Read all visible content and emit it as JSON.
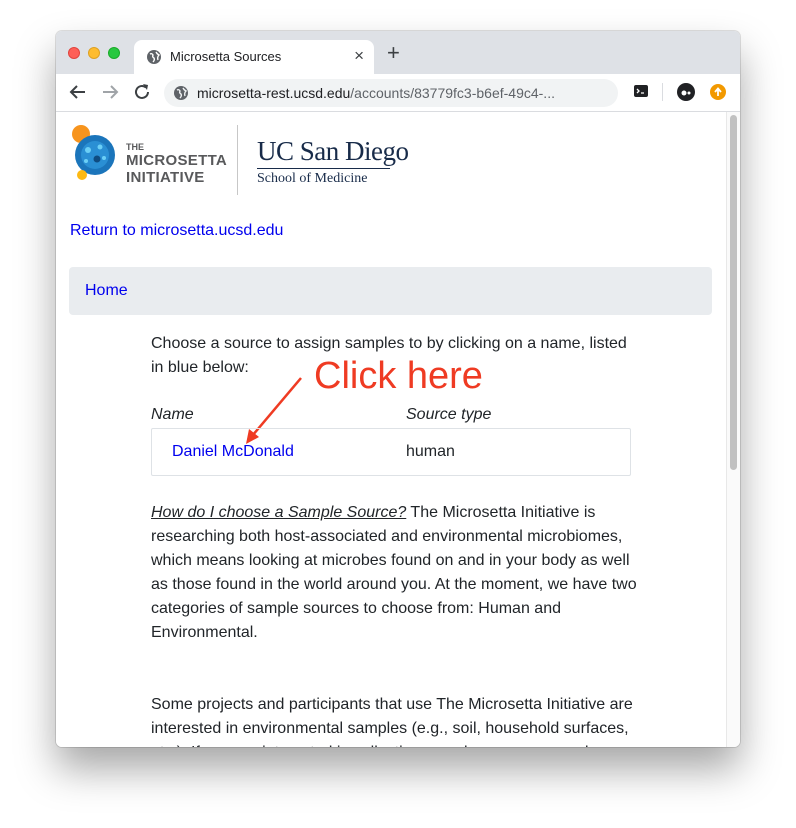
{
  "browser": {
    "tab_title": "Microsetta Sources",
    "tab_close": "×",
    "new_tab": "+",
    "url_host": "microsetta-rest.ucsd.edu",
    "url_path": "/accounts/83779fc3-b6ef-49c4-..."
  },
  "header": {
    "logo_line1": "THE",
    "logo_line2": "MICROSETTA",
    "logo_line3": "INITIATIVE",
    "ucsd_line1": "UC San Diego",
    "ucsd_line2": "School of Medicine"
  },
  "nav": {
    "return_link": "Return to microsetta.ucsd.edu",
    "breadcrumb_home": "Home"
  },
  "main": {
    "instructions": "Choose a source to assign samples to by clicking on a name, listed in blue below:",
    "col_name": "Name",
    "col_type": "Source type",
    "sources": [
      {
        "name": "Daniel McDonald",
        "type": "human"
      }
    ],
    "annotation": "Click here",
    "faq_question": "How do I choose a Sample Source?",
    "faq_answer": " The Microsetta Initiative is researching both host-associated and environmental microbiomes, which means looking at microbes found on and in your body as well as those found in the world around you. At the moment, we have two categories of sample sources to choose from: Human and Environmental.",
    "para2": "Some projects and participants that use The Microsetta Initiative are interested in environmental samples (e.g., soil, household surfaces, etc.). If you are interested in collecting samples, you can send us"
  },
  "colors": {
    "link": "#0000ee",
    "annotation": "#ef3b23",
    "brand_blue": "#182b49"
  }
}
